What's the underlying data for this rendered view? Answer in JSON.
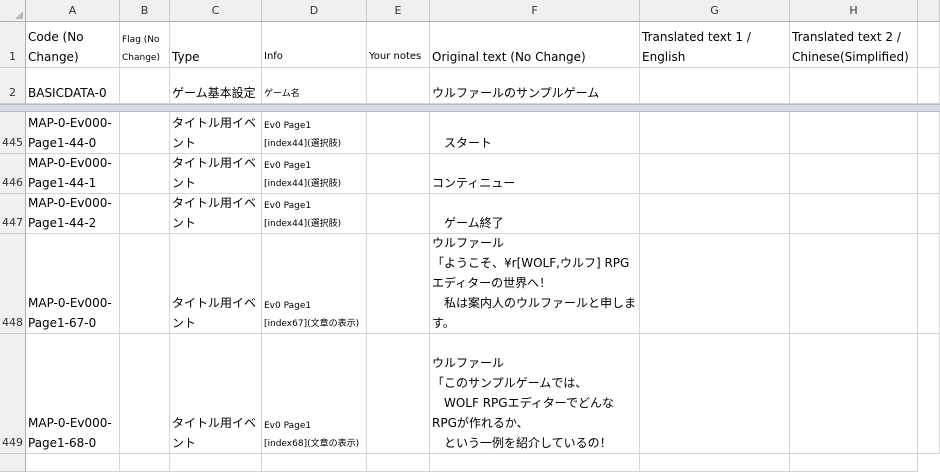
{
  "columns": [
    "A",
    "B",
    "C",
    "D",
    "E",
    "F",
    "G",
    "H"
  ],
  "header_row": {
    "num": "1",
    "A": "Code (No\nChange)",
    "B": "Flag (No\nChange)",
    "C": "Type",
    "D": "Info",
    "E": "Your notes",
    "F": "Original text (No Change)",
    "G": "Translated text 1 /\nEnglish",
    "H": "Translated text 2 /\nChinese(Simplified)"
  },
  "row2": {
    "num": "2",
    "A": "BASICDATA-0",
    "C": "ゲーム基本設定",
    "D": "ゲーム名",
    "F": "ウルファールのサンプルゲーム"
  },
  "rows": [
    {
      "num": "445",
      "A": "MAP-0-Ev000-\nPage1-44-0",
      "C": "タイトル用イベ\nント",
      "D": "Ev0 Page1\n[index44](選択肢)",
      "F": "　スタート"
    },
    {
      "num": "446",
      "A": "MAP-0-Ev000-\nPage1-44-1",
      "C": "タイトル用イベ\nント",
      "D": "Ev0 Page1\n[index44](選択肢)",
      "F": "コンティニュー"
    },
    {
      "num": "447",
      "A": "MAP-0-Ev000-\nPage1-44-2",
      "C": "タイトル用イベ\nント",
      "D": "Ev0 Page1\n[index44](選択肢)",
      "F": "　ゲーム終了"
    },
    {
      "num": "448",
      "A": "MAP-0-Ev000-\nPage1-67-0",
      "C": "タイトル用イベ\nント",
      "D": "Ev0 Page1\n[index67](文章の表示)",
      "F": "ウルファール\n「ようこそ、¥r[WOLF,ウルフ] RPG\nエディターの世界へ！\n　私は案内人のウルファールと申しま\nす。"
    },
    {
      "num": "449",
      "A": "MAP-0-Ev000-\nPage1-68-0",
      "C": "タイトル用イベ\nント",
      "D": "Ev0 Page1\n[index68](文章の表示)",
      "F": "ウルファール\n「このサンプルゲームでは、\n　WOLF RPGエディターでどんな\nRPGが作れるか、\n　という一例を紹介しているの！"
    }
  ]
}
